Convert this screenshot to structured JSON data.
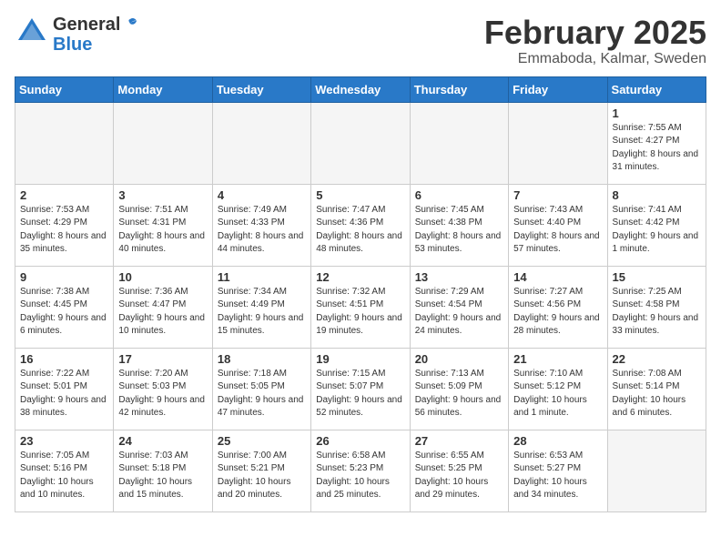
{
  "header": {
    "logo_general": "General",
    "logo_blue": "Blue",
    "month_title": "February 2025",
    "location": "Emmaboda, Kalmar, Sweden"
  },
  "weekdays": [
    "Sunday",
    "Monday",
    "Tuesday",
    "Wednesday",
    "Thursday",
    "Friday",
    "Saturday"
  ],
  "weeks": [
    [
      {
        "day": "",
        "info": ""
      },
      {
        "day": "",
        "info": ""
      },
      {
        "day": "",
        "info": ""
      },
      {
        "day": "",
        "info": ""
      },
      {
        "day": "",
        "info": ""
      },
      {
        "day": "",
        "info": ""
      },
      {
        "day": "1",
        "info": "Sunrise: 7:55 AM\nSunset: 4:27 PM\nDaylight: 8 hours\nand 31 minutes."
      }
    ],
    [
      {
        "day": "2",
        "info": "Sunrise: 7:53 AM\nSunset: 4:29 PM\nDaylight: 8 hours\nand 35 minutes."
      },
      {
        "day": "3",
        "info": "Sunrise: 7:51 AM\nSunset: 4:31 PM\nDaylight: 8 hours\nand 40 minutes."
      },
      {
        "day": "4",
        "info": "Sunrise: 7:49 AM\nSunset: 4:33 PM\nDaylight: 8 hours\nand 44 minutes."
      },
      {
        "day": "5",
        "info": "Sunrise: 7:47 AM\nSunset: 4:36 PM\nDaylight: 8 hours\nand 48 minutes."
      },
      {
        "day": "6",
        "info": "Sunrise: 7:45 AM\nSunset: 4:38 PM\nDaylight: 8 hours\nand 53 minutes."
      },
      {
        "day": "7",
        "info": "Sunrise: 7:43 AM\nSunset: 4:40 PM\nDaylight: 8 hours\nand 57 minutes."
      },
      {
        "day": "8",
        "info": "Sunrise: 7:41 AM\nSunset: 4:42 PM\nDaylight: 9 hours\nand 1 minute."
      }
    ],
    [
      {
        "day": "9",
        "info": "Sunrise: 7:38 AM\nSunset: 4:45 PM\nDaylight: 9 hours\nand 6 minutes."
      },
      {
        "day": "10",
        "info": "Sunrise: 7:36 AM\nSunset: 4:47 PM\nDaylight: 9 hours\nand 10 minutes."
      },
      {
        "day": "11",
        "info": "Sunrise: 7:34 AM\nSunset: 4:49 PM\nDaylight: 9 hours\nand 15 minutes."
      },
      {
        "day": "12",
        "info": "Sunrise: 7:32 AM\nSunset: 4:51 PM\nDaylight: 9 hours\nand 19 minutes."
      },
      {
        "day": "13",
        "info": "Sunrise: 7:29 AM\nSunset: 4:54 PM\nDaylight: 9 hours\nand 24 minutes."
      },
      {
        "day": "14",
        "info": "Sunrise: 7:27 AM\nSunset: 4:56 PM\nDaylight: 9 hours\nand 28 minutes."
      },
      {
        "day": "15",
        "info": "Sunrise: 7:25 AM\nSunset: 4:58 PM\nDaylight: 9 hours\nand 33 minutes."
      }
    ],
    [
      {
        "day": "16",
        "info": "Sunrise: 7:22 AM\nSunset: 5:01 PM\nDaylight: 9 hours\nand 38 minutes."
      },
      {
        "day": "17",
        "info": "Sunrise: 7:20 AM\nSunset: 5:03 PM\nDaylight: 9 hours\nand 42 minutes."
      },
      {
        "day": "18",
        "info": "Sunrise: 7:18 AM\nSunset: 5:05 PM\nDaylight: 9 hours\nand 47 minutes."
      },
      {
        "day": "19",
        "info": "Sunrise: 7:15 AM\nSunset: 5:07 PM\nDaylight: 9 hours\nand 52 minutes."
      },
      {
        "day": "20",
        "info": "Sunrise: 7:13 AM\nSunset: 5:09 PM\nDaylight: 9 hours\nand 56 minutes."
      },
      {
        "day": "21",
        "info": "Sunrise: 7:10 AM\nSunset: 5:12 PM\nDaylight: 10 hours\nand 1 minute."
      },
      {
        "day": "22",
        "info": "Sunrise: 7:08 AM\nSunset: 5:14 PM\nDaylight: 10 hours\nand 6 minutes."
      }
    ],
    [
      {
        "day": "23",
        "info": "Sunrise: 7:05 AM\nSunset: 5:16 PM\nDaylight: 10 hours\nand 10 minutes."
      },
      {
        "day": "24",
        "info": "Sunrise: 7:03 AM\nSunset: 5:18 PM\nDaylight: 10 hours\nand 15 minutes."
      },
      {
        "day": "25",
        "info": "Sunrise: 7:00 AM\nSunset: 5:21 PM\nDaylight: 10 hours\nand 20 minutes."
      },
      {
        "day": "26",
        "info": "Sunrise: 6:58 AM\nSunset: 5:23 PM\nDaylight: 10 hours\nand 25 minutes."
      },
      {
        "day": "27",
        "info": "Sunrise: 6:55 AM\nSunset: 5:25 PM\nDaylight: 10 hours\nand 29 minutes."
      },
      {
        "day": "28",
        "info": "Sunrise: 6:53 AM\nSunset: 5:27 PM\nDaylight: 10 hours\nand 34 minutes."
      },
      {
        "day": "",
        "info": ""
      }
    ]
  ]
}
